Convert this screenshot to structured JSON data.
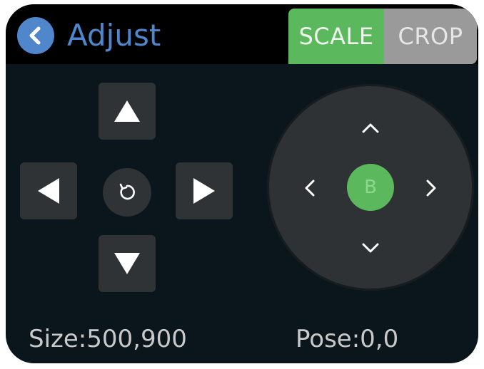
{
  "header": {
    "title": "Adjust",
    "back_icon": "chevron-left-icon",
    "modes": [
      {
        "label": "SCALE",
        "active": true,
        "color": "#5cb85c"
      },
      {
        "label": "CROP",
        "active": false,
        "color": "#9a9a9a"
      }
    ]
  },
  "dpad": {
    "up_icon": "triangle-up-icon",
    "down_icon": "triangle-down-icon",
    "left_icon": "triangle-left-icon",
    "right_icon": "triangle-right-icon",
    "reset_icon": "rotate-reset-icon"
  },
  "joystick": {
    "center_label": "B",
    "up_icon": "chevron-up-icon",
    "down_icon": "chevron-down-icon",
    "left_icon": "chevron-left-icon",
    "right_icon": "chevron-right-icon"
  },
  "status": {
    "size_text": "Size:500,900",
    "pose_text": "Pose:0,0"
  },
  "colors": {
    "accent_blue": "#4f86cc",
    "accent_green": "#5cb85c",
    "background": "#0a151c",
    "button": "#2f3336"
  }
}
